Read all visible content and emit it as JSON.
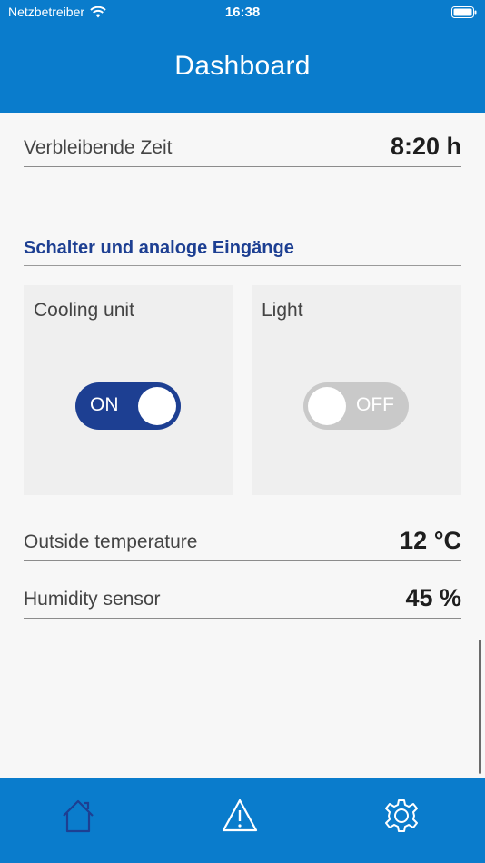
{
  "status_bar": {
    "carrier": "Netzbetreiber",
    "time": "16:38"
  },
  "header": {
    "title": "Dashboard"
  },
  "rows": {
    "remaining": {
      "label": "Verbleibende Zeit",
      "value": "8:20 h"
    },
    "outside_temp": {
      "label": "Outside temperature",
      "value": "12 °C"
    },
    "humidity": {
      "label": "Humidity sensor",
      "value": "45 %"
    }
  },
  "section": {
    "title": "Schalter und analoge Eingänge"
  },
  "switches": [
    {
      "label": "Cooling unit",
      "state_label": "ON",
      "on": true
    },
    {
      "label": "Light",
      "state_label": "OFF",
      "on": false
    }
  ],
  "tabbar": {
    "icons": [
      "home-icon",
      "warning-icon",
      "settings-gear-icon"
    ]
  },
  "colors": {
    "header": "#0a7ccc",
    "accent": "#1d3f92",
    "toggle_off": "#c9c9c9",
    "background": "#f7f7f7"
  }
}
